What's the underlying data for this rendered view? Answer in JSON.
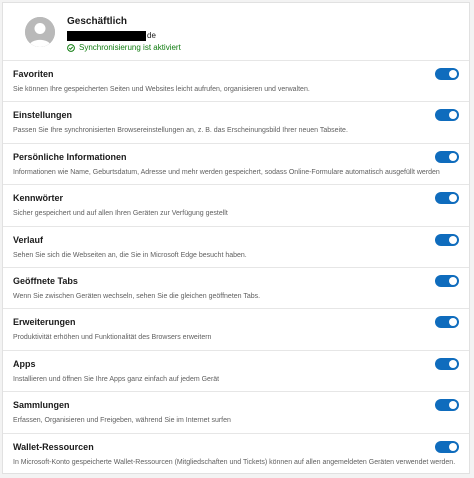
{
  "account": {
    "name": "Geschäftlich",
    "email_domain": "de",
    "sync_status": "Synchronisierung ist aktiviert"
  },
  "colors": {
    "toggle_on": "#0f6cbd",
    "sync_green": "#107c10"
  },
  "icons": {
    "avatar": "person-avatar-icon",
    "sync": "check-circle-icon"
  },
  "settings": [
    {
      "title": "Favoriten",
      "description": "Sie können Ihre gespeicherten Seiten und Websites leicht aufrufen, organisieren und verwalten.",
      "enabled": true
    },
    {
      "title": "Einstellungen",
      "description": "Passen Sie Ihre synchronisierten Browsereinstellungen an, z. B. das Erscheinungsbild Ihrer neuen Tabseite.",
      "enabled": true
    },
    {
      "title": "Persönliche Informationen",
      "description": "Informationen wie Name, Geburtsdatum, Adresse und mehr werden gespeichert, sodass Online-Formulare automatisch ausgefüllt werden",
      "enabled": true
    },
    {
      "title": "Kennwörter",
      "description": "Sicher gespeichert und auf allen Ihren Geräten zur Verfügung gestellt",
      "enabled": true
    },
    {
      "title": "Verlauf",
      "description": "Sehen Sie sich die Webseiten an, die Sie in Microsoft Edge besucht haben.",
      "enabled": true
    },
    {
      "title": "Geöffnete Tabs",
      "description": "Wenn Sie zwischen Geräten wechseln, sehen Sie die gleichen geöffneten Tabs.",
      "enabled": true
    },
    {
      "title": "Erweiterungen",
      "description": "Produktivität erhöhen und Funktionalität des Browsers erweitern",
      "enabled": true
    },
    {
      "title": "Apps",
      "description": "Installieren und öffnen Sie Ihre Apps ganz einfach auf jedem Gerät",
      "enabled": true
    },
    {
      "title": "Sammlungen",
      "description": "Erfassen, Organisieren und Freigeben, während Sie im Internet surfen",
      "enabled": true
    },
    {
      "title": "Wallet-Ressourcen",
      "description": "In Microsoft-Konto gespeicherte Wallet-Ressourcen (Mitgliedschaften und Tickets) können auf allen angemeldeten Geräten verwendet werden.",
      "enabled": true
    }
  ]
}
